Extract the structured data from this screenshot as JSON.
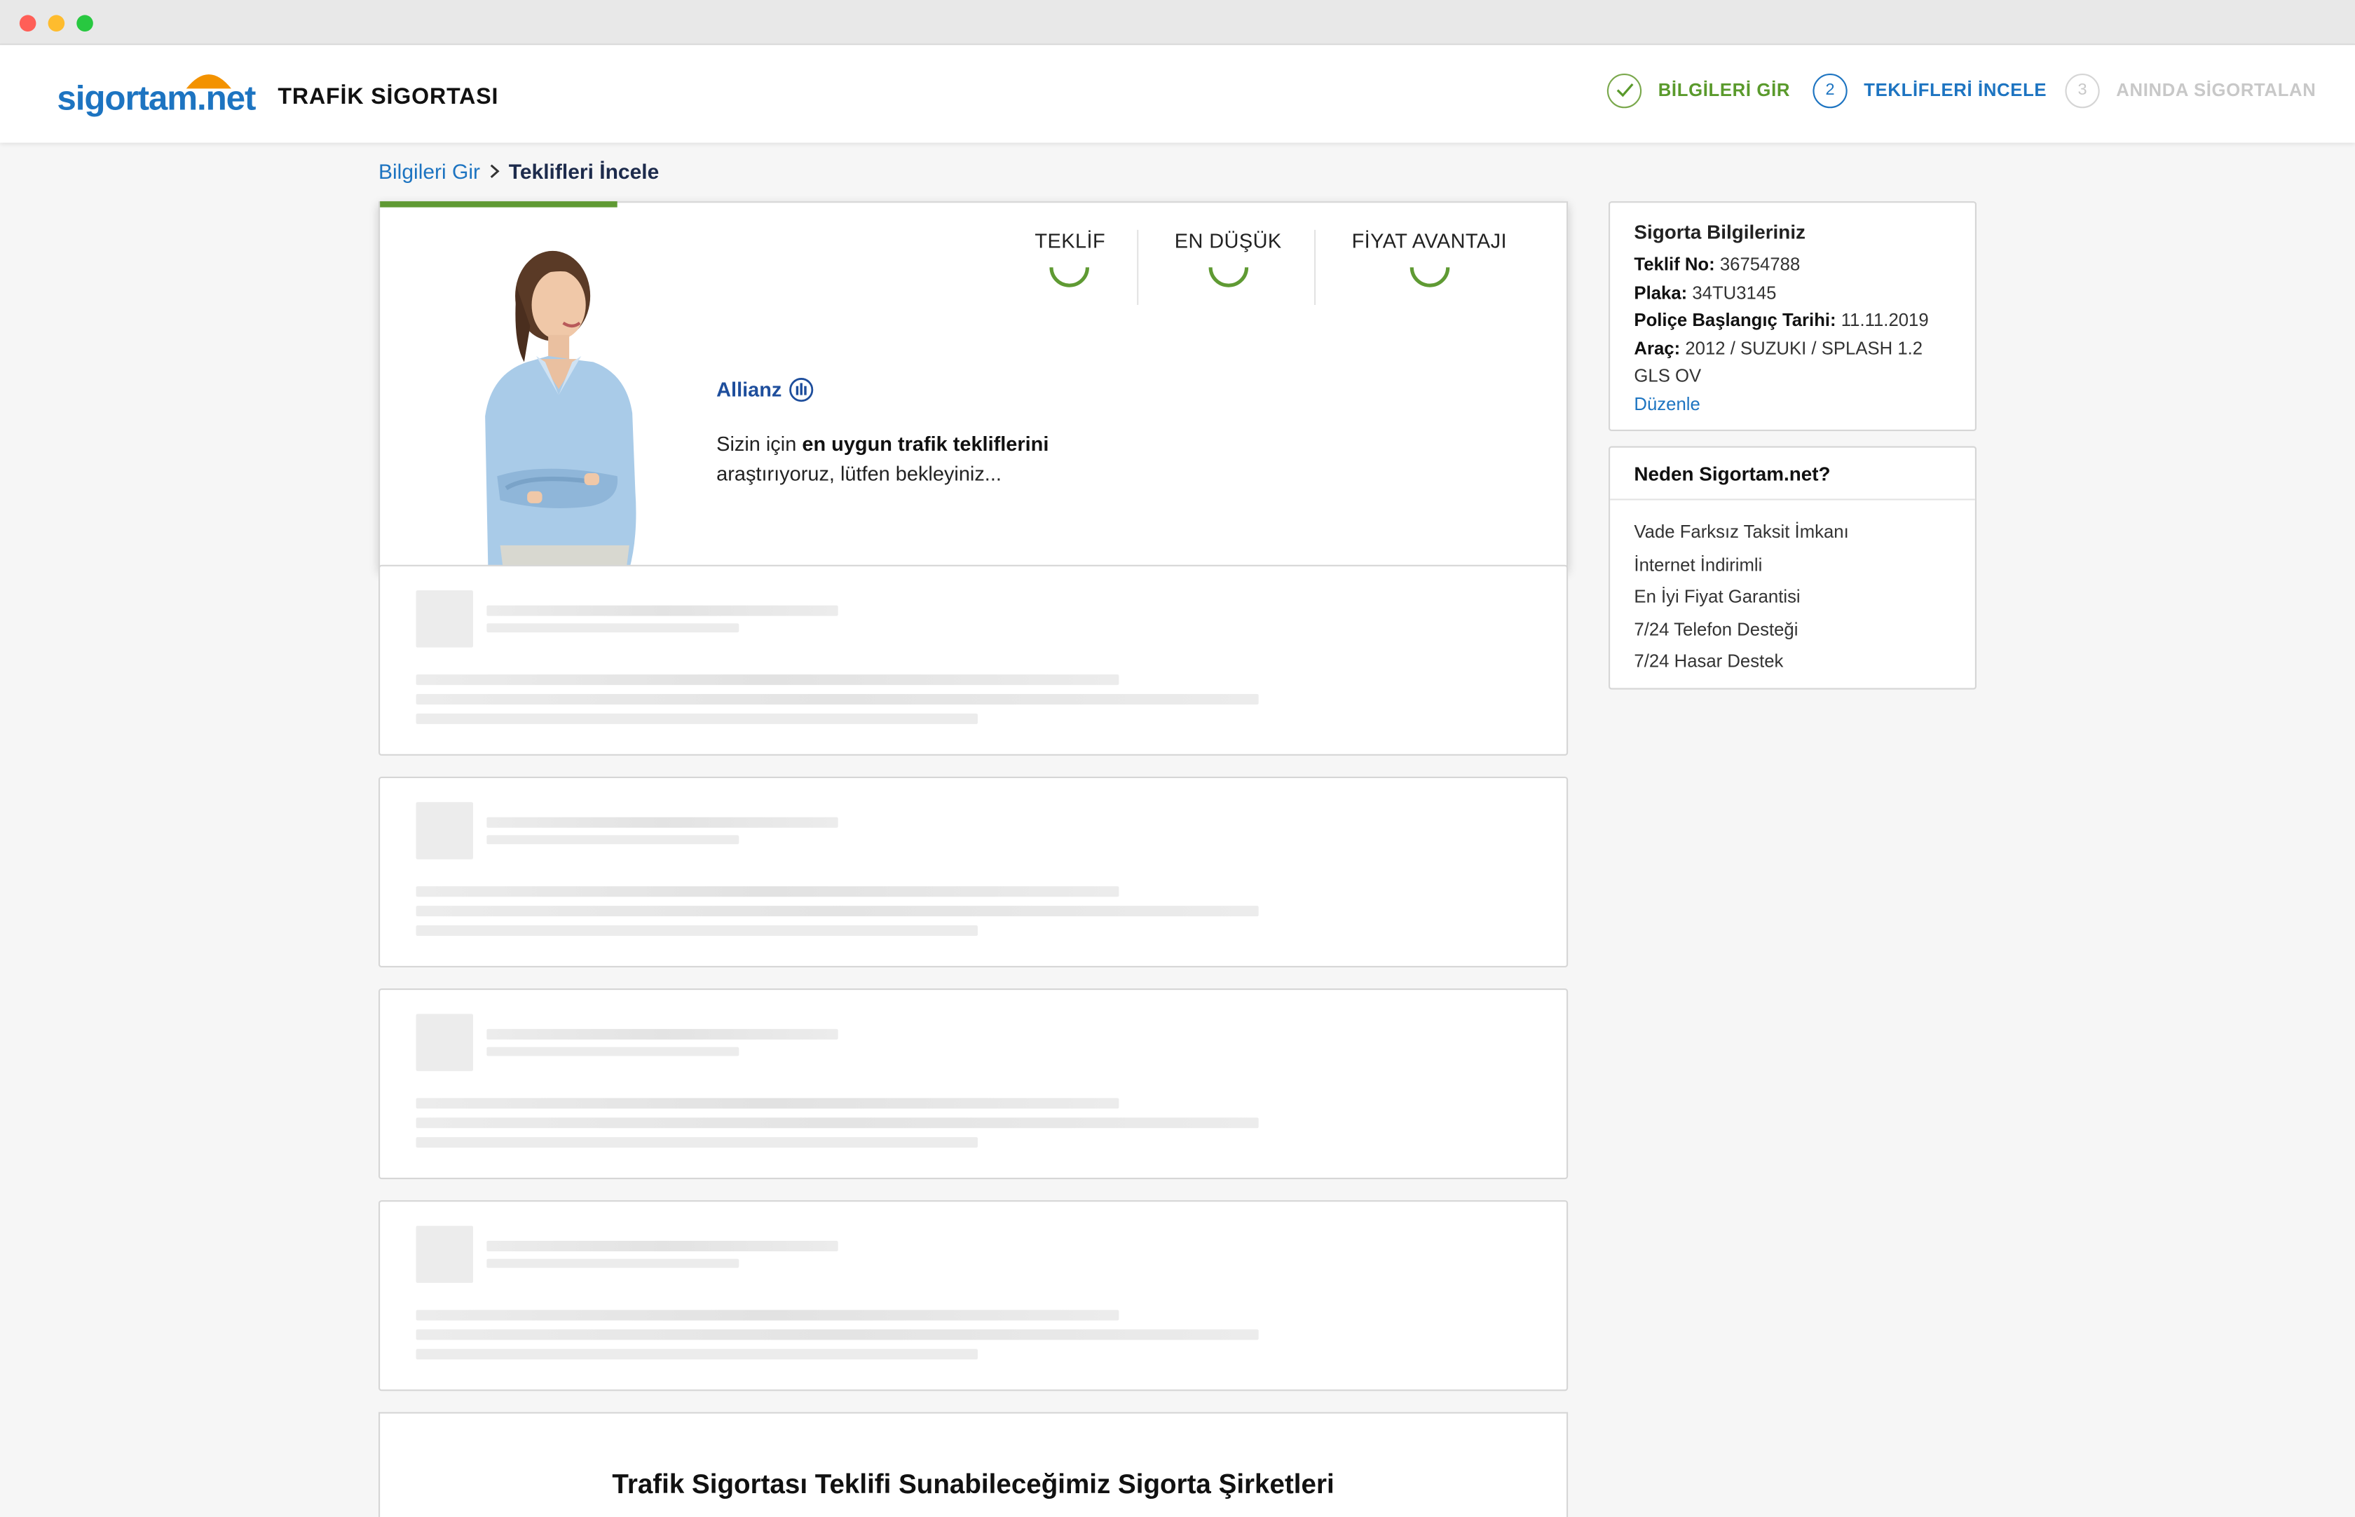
{
  "header": {
    "logo_text": "sigortam.net",
    "product_title": "TRAFİK SİGORTASI",
    "steps": [
      {
        "number": "",
        "label": "BİLGİLERİ GİR",
        "state": "completed"
      },
      {
        "number": "2",
        "label": "TEKLİFLERİ İNCELE",
        "state": "active"
      },
      {
        "number": "3",
        "label": "ANINDA SİGORTALAN",
        "state": "disabled"
      }
    ]
  },
  "breadcrumb": {
    "link": "Bilgileri Gir",
    "current": "Teklifleri İncele"
  },
  "hero": {
    "progress": 0.2,
    "metrics": [
      {
        "label": "TEKLİF"
      },
      {
        "label": "EN DÜŞÜK"
      },
      {
        "label": "FİYAT AVANTAJI"
      }
    ],
    "brand": "Allianz",
    "wait_text_prefix": "Sizin için ",
    "wait_text_bold": "en uygun trafik tekliflerini",
    "wait_text_suffix": "araştırıyoruz, lütfen bekleyiniz..."
  },
  "bottom": {
    "title": "Trafik Sigortası Teklifi Sunabileceğimiz Sigorta Şirketleri"
  },
  "info": {
    "title": "Sigorta Bilgileriniz",
    "rows": [
      {
        "label": "Teklif No:",
        "value": "36754788"
      },
      {
        "label": "Plaka:",
        "value": "34TU3145"
      },
      {
        "label": "Poliçe Başlangıç Tarihi:",
        "value": "11.11.2019"
      },
      {
        "label": "Araç:",
        "value": "2012 / SUZUKI / SPLASH 1.2 GLS OV"
      }
    ],
    "edit_label": "Düzenle"
  },
  "why": {
    "title": "Neden Sigortam.net?",
    "items": [
      "Vade Farksız Taksit İmkanı",
      "İnternet İndirimli",
      "En İyi Fiyat Garantisi",
      "7/24 Telefon Desteği",
      "7/24 Hasar Destek"
    ]
  },
  "colors": {
    "brand_blue": "#1d74c1",
    "success_green": "#5f9a33",
    "logo_orange": "#f39200"
  }
}
